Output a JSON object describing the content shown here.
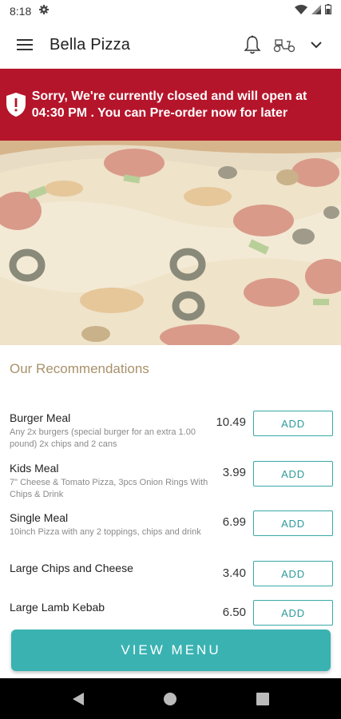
{
  "status_bar": {
    "time": "8:18"
  },
  "app_bar": {
    "title": "Bella Pizza"
  },
  "banner": {
    "message": "Sorry, We're currently closed and will open at 04:30 PM . You can Pre-order now for later"
  },
  "recommendations": {
    "title": "Our Recommendations",
    "add_label": "ADD",
    "items": [
      {
        "name": "Burger Meal",
        "description": "Any 2x burgers (special burger for an extra 1.00 pound) 2x chips and 2 cans",
        "price": "10.49"
      },
      {
        "name": "Kids Meal",
        "description": "7\" Cheese & Tomato Pizza, 3pcs Onion Rings With Chips & Drink",
        "price": "3.99"
      },
      {
        "name": "Single Meal",
        "description": "10inch Pizza with any 2 toppings, chips and drink",
        "price": "6.99"
      },
      {
        "name": "Large Chips and Cheese",
        "description": "",
        "price": "3.40"
      },
      {
        "name": "Large Lamb Kebab",
        "description": "",
        "price": "6.50"
      }
    ]
  },
  "view_menu_label": "VIEW MENU",
  "colors": {
    "banner_red": "#b5152b",
    "accent_teal": "#3ab2b2",
    "section_gold": "#a8916a"
  },
  "icons": [
    "gear-icon",
    "wifi-icon",
    "signal-icon",
    "battery-icon",
    "hamburger-menu-icon",
    "bell-icon",
    "scooter-icon",
    "chevron-down-icon",
    "shield-alert-icon",
    "back-icon",
    "home-icon",
    "recents-icon"
  ]
}
